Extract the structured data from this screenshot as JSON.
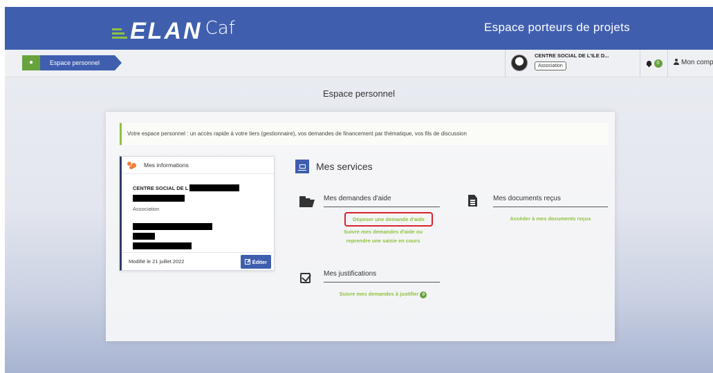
{
  "header": {
    "logo_primary": "ELAN",
    "logo_secondary": "Caf",
    "space_title": "Espace porteurs de projets"
  },
  "breadcrumb": {
    "home_icon": "home-icon",
    "current": "Espace personnel"
  },
  "org": {
    "name": "CENTRE SOCIAL DE L'ILE D...",
    "type": "Association"
  },
  "notifications": {
    "count": "0"
  },
  "account": {
    "label": "Mon compte"
  },
  "page": {
    "heading": "Espace personnel"
  },
  "intro": {
    "text": "Votre espace personnel : un accès rapide à votre tiers (gestionnaire), vos demandes de financement par thématique, vos fils de discussion"
  },
  "info_panel": {
    "title": "Mes informations",
    "name": "CENTRE SOCIAL DE L",
    "type": "Association",
    "modified": "Modifié le 21 juillet 2022",
    "edit_label": "Éditer"
  },
  "services": {
    "title": "Mes services",
    "demandes": {
      "title": "Mes demandes d'aide",
      "link_deposer": "Déposer une demande d'aide",
      "link_suivre_1": "Suivre mes demandes d'aide ou",
      "link_suivre_2": "reprendre une saisie en cours"
    },
    "documents": {
      "title": "Mes documents reçus",
      "link": "Accéder à mes documents reçus"
    },
    "justifications": {
      "title": "Mes justifications",
      "link": "Suivre mes demandes à justifier",
      "badge": "0"
    }
  },
  "colors": {
    "primary": "#3f5fae",
    "accent_green": "#8fc23f",
    "highlight_red": "#d7232d"
  }
}
